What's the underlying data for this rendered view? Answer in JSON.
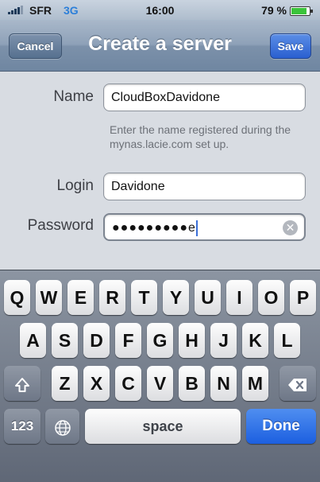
{
  "status_bar": {
    "carrier": "SFR",
    "network": "3G",
    "time": "16:00",
    "battery": "79 %"
  },
  "nav": {
    "title": "Create a server",
    "cancel_label": "Cancel",
    "save_label": "Save"
  },
  "form": {
    "name_label": "Name",
    "name_value": "CloudBoxDavidone",
    "name_help": "Enter the name registered during the mynas.lacie.com set up.",
    "login_label": "Login",
    "login_value": "Davidone",
    "password_label": "Password",
    "password_masked": "●●●●●●●●●",
    "password_last_char": "e"
  },
  "keyboard": {
    "row1": [
      "Q",
      "W",
      "E",
      "R",
      "T",
      "Y",
      "U",
      "I",
      "O",
      "P"
    ],
    "row2": [
      "A",
      "S",
      "D",
      "F",
      "G",
      "H",
      "J",
      "K",
      "L"
    ],
    "row3": [
      "Z",
      "X",
      "C",
      "V",
      "B",
      "N",
      "M"
    ],
    "numbers_key": "123",
    "space_key": "space",
    "done_key": "Done"
  },
  "colors": {
    "done_blue": "#1c5fe0",
    "network_blue": "#2c7fd9"
  }
}
